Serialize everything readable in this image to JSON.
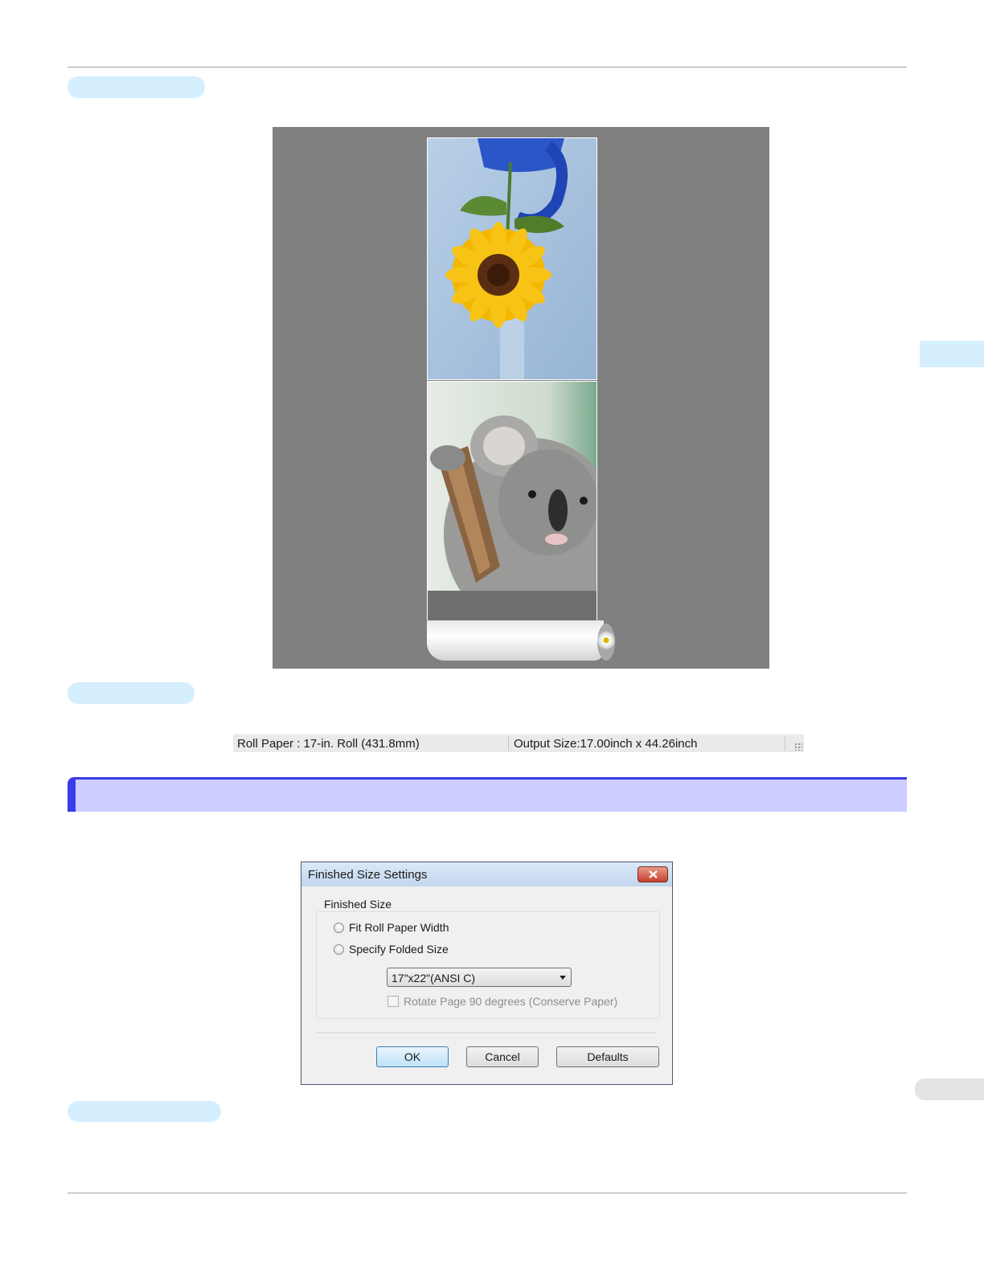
{
  "preview": {
    "status_paper": "Roll Paper : 17-in. Roll (431.8mm)",
    "status_output": "Output Size:17.00inch x 44.26inch"
  },
  "dialog": {
    "title": "Finished Size Settings",
    "group_title": "Finished Size",
    "option_fit": "Fit Roll Paper Width",
    "option_specify": "Specify Folded Size",
    "selected_size": "17\"x22\"(ANSI C)",
    "rotate_label": "Rotate Page 90 degrees (Conserve Paper)",
    "ok_label": "OK",
    "cancel_label": "Cancel",
    "defaults_label": "Defaults"
  },
  "colors": {
    "pill": "#d6efff",
    "section_bar": "#ccccff",
    "section_accent": "#3a3ae8",
    "preview_bg": "#808080"
  }
}
